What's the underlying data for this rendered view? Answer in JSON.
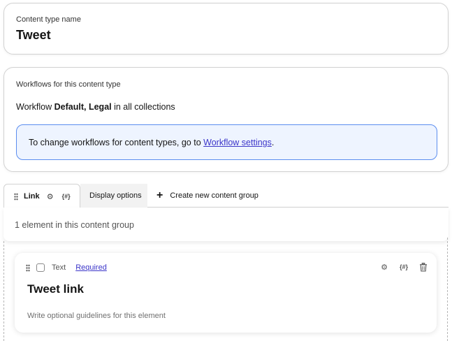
{
  "content_type": {
    "label": "Content type name",
    "name": "Tweet"
  },
  "workflows": {
    "label": "Workflows for this content type",
    "prefix": "Workflow",
    "names": "Default, Legal",
    "suffix": "in all collections",
    "info_text": "To change workflows for content types, go to",
    "info_link": "Workflow settings",
    "info_end": "."
  },
  "tabs": {
    "active_label": "Link",
    "display_options": "Display options",
    "create_group": "Create new content group"
  },
  "group": {
    "count_text": "1 element in this content group"
  },
  "element": {
    "type": "Text",
    "required": "Required",
    "title": "Tweet link",
    "guidelines_placeholder": "Write optional guidelines for this element"
  },
  "icons": {
    "drag": "drag-handle-icon",
    "settings": "gear-icon",
    "snippet": "braces-icon",
    "delete": "trash-icon",
    "add": "plus-icon"
  },
  "colors": {
    "accent_link": "#3b35c9",
    "info_bg": "#eef4ff",
    "info_border": "#5b8def"
  }
}
